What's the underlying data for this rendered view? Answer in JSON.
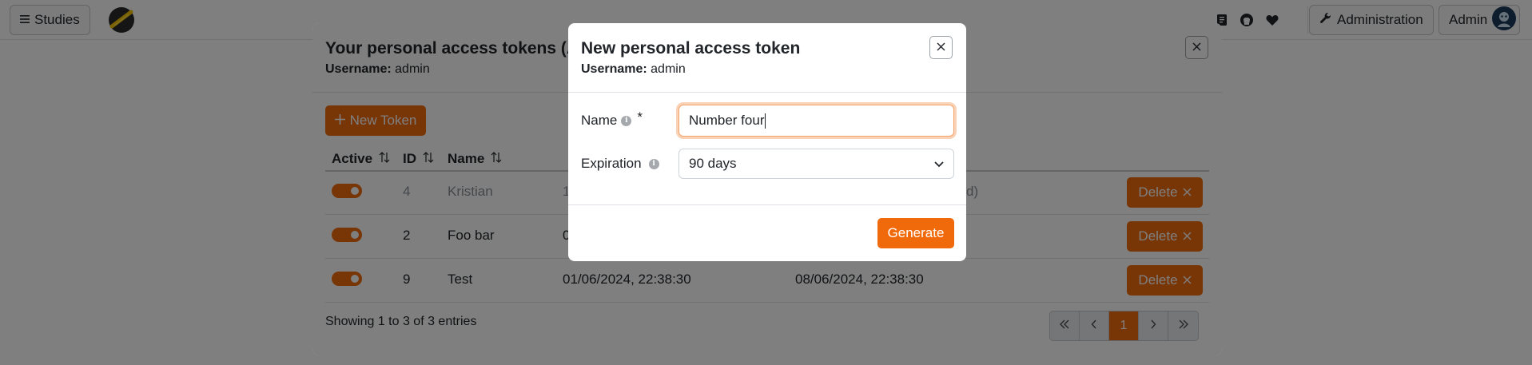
{
  "navbar": {
    "studies_label": "Studies",
    "administration_label": "Administration",
    "user_label": "Admin"
  },
  "tokens_modal": {
    "title": "Your personal access tokens (API",
    "username_label": "Username:",
    "username_value": "admin",
    "new_token_label": "New Token",
    "columns": [
      "Active",
      "ID",
      "Name"
    ],
    "rows": [
      {
        "id": "4",
        "name": "Kristian",
        "created": "1",
        "expires": "d)",
        "active": true,
        "muted": true
      },
      {
        "id": "2",
        "name": "Foo bar",
        "created": "0",
        "expires": "",
        "active": true,
        "muted": false
      },
      {
        "id": "9",
        "name": "Test",
        "created": "01/06/2024, 22:38:30",
        "expires": "08/06/2024, 22:38:30",
        "active": true,
        "muted": false
      }
    ],
    "delete_label": "Delete",
    "footer": "Showing 1 to 3 of 3 entries",
    "current_page": "1"
  },
  "new_token_modal": {
    "title": "New personal access token",
    "username_label": "Username:",
    "username_value": "admin",
    "name_label": "Name",
    "name_required": "*",
    "name_value": "Number four",
    "expiration_label": "Expiration",
    "expiration_value": "90 days",
    "generate_label": "Generate"
  },
  "colors": {
    "accent": "#f06a0c",
    "backdrop": "rgba(0,0,0,0.5)"
  }
}
